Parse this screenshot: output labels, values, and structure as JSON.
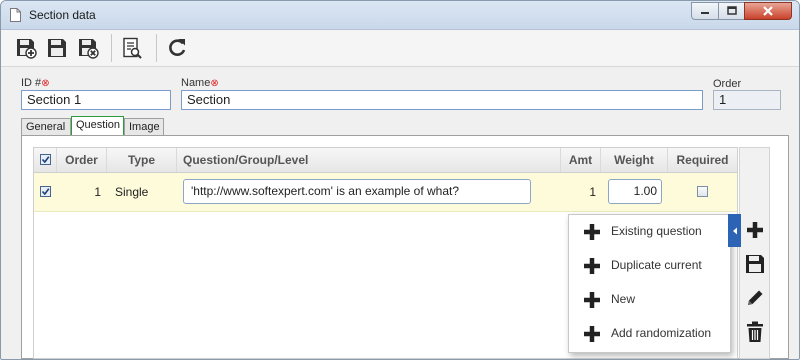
{
  "window": {
    "title": "Section data",
    "controls": {
      "minimize_icon": "minimize-icon",
      "maximize_icon": "maximize-icon",
      "close_icon": "close-icon"
    }
  },
  "toolbar": {
    "buttons": [
      {
        "icon": "save-new-icon",
        "label": ""
      },
      {
        "icon": "save-icon",
        "label": ""
      },
      {
        "icon": "save-close-icon",
        "label": ""
      },
      {
        "icon": "report-icon",
        "label": ""
      },
      {
        "icon": "refresh-icon",
        "label": ""
      }
    ]
  },
  "form": {
    "id_label": "ID #",
    "id_value": "Section 1",
    "name_label": "Name",
    "name_value": "Section",
    "order_label": "Order",
    "order_value": "1",
    "required_marker": "⊗"
  },
  "tabs": [
    {
      "label": "General",
      "active": false
    },
    {
      "label": "Question",
      "active": true
    },
    {
      "label": "Image",
      "active": false
    }
  ],
  "grid": {
    "columns": [
      "Order",
      "Type",
      "Question/Group/Level",
      "Amt",
      "Weight",
      "Required"
    ],
    "rows": [
      {
        "checked": true,
        "order": "1",
        "type": "Single",
        "question": "'http://www.softexpert.com' is an example of what?",
        "amt": "1",
        "weight": "1.00",
        "required": false
      }
    ],
    "select_all_checked": true
  },
  "sidebar": {
    "buttons": [
      {
        "icon": "plus-icon"
      },
      {
        "icon": "save-icon"
      },
      {
        "icon": "pencil-icon"
      },
      {
        "icon": "trash-icon"
      }
    ]
  },
  "add_menu": {
    "items": [
      {
        "label": "Existing question",
        "icon": "plus-icon"
      },
      {
        "label": "Duplicate current",
        "icon": "plus-icon"
      },
      {
        "label": "New",
        "icon": "plus-icon"
      },
      {
        "label": "Add randomization",
        "icon": "plus-icon"
      }
    ]
  },
  "colors": {
    "accent": "#2c63b5",
    "row_highlight": "#fdfbd9",
    "required_marker": "#dd2222",
    "active_tab_border": "#2f9a3a"
  }
}
